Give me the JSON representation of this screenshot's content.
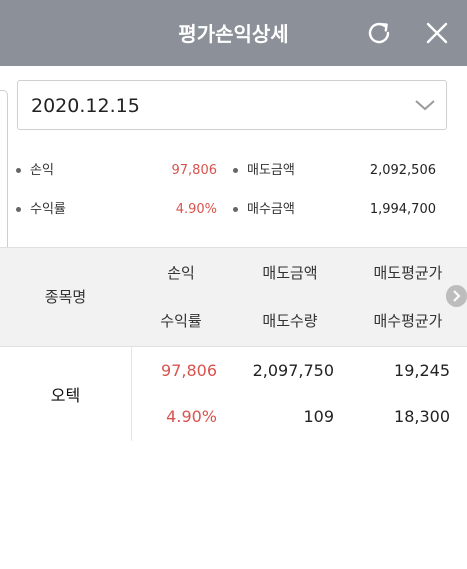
{
  "header": {
    "title": "평가손익상세",
    "refresh_icon": "refresh-icon",
    "close_icon": "close-icon"
  },
  "date_select": {
    "value": "2020.12.15",
    "icon": "chevron-down-icon"
  },
  "summary": {
    "profit_label": "손익",
    "profit_value": "97,806",
    "sell_amount_label": "매도금액",
    "sell_amount_value": "2,092,506",
    "return_label": "수익률",
    "return_value": "4.90%",
    "buy_amount_label": "매수금액",
    "buy_amount_value": "1,994,700"
  },
  "table": {
    "headers": {
      "stock_name": "종목명",
      "profit": "손익",
      "sell_amount": "매도금액",
      "avg_sell_price": "매도평균가",
      "return": "수익률",
      "sell_quantity": "매도수량",
      "avg_buy_price": "매수평균가"
    },
    "rows": [
      {
        "name": "오텍",
        "profit": "97,806",
        "sell_amount": "2,097,750",
        "avg_sell_price": "19,245",
        "return": "4.90%",
        "sell_quantity": "109",
        "avg_buy_price": "18,300"
      }
    ]
  },
  "colors": {
    "header_bg": "#8b9099",
    "positive": "#d9534f",
    "table_head_bg": "#f2f2f2"
  }
}
